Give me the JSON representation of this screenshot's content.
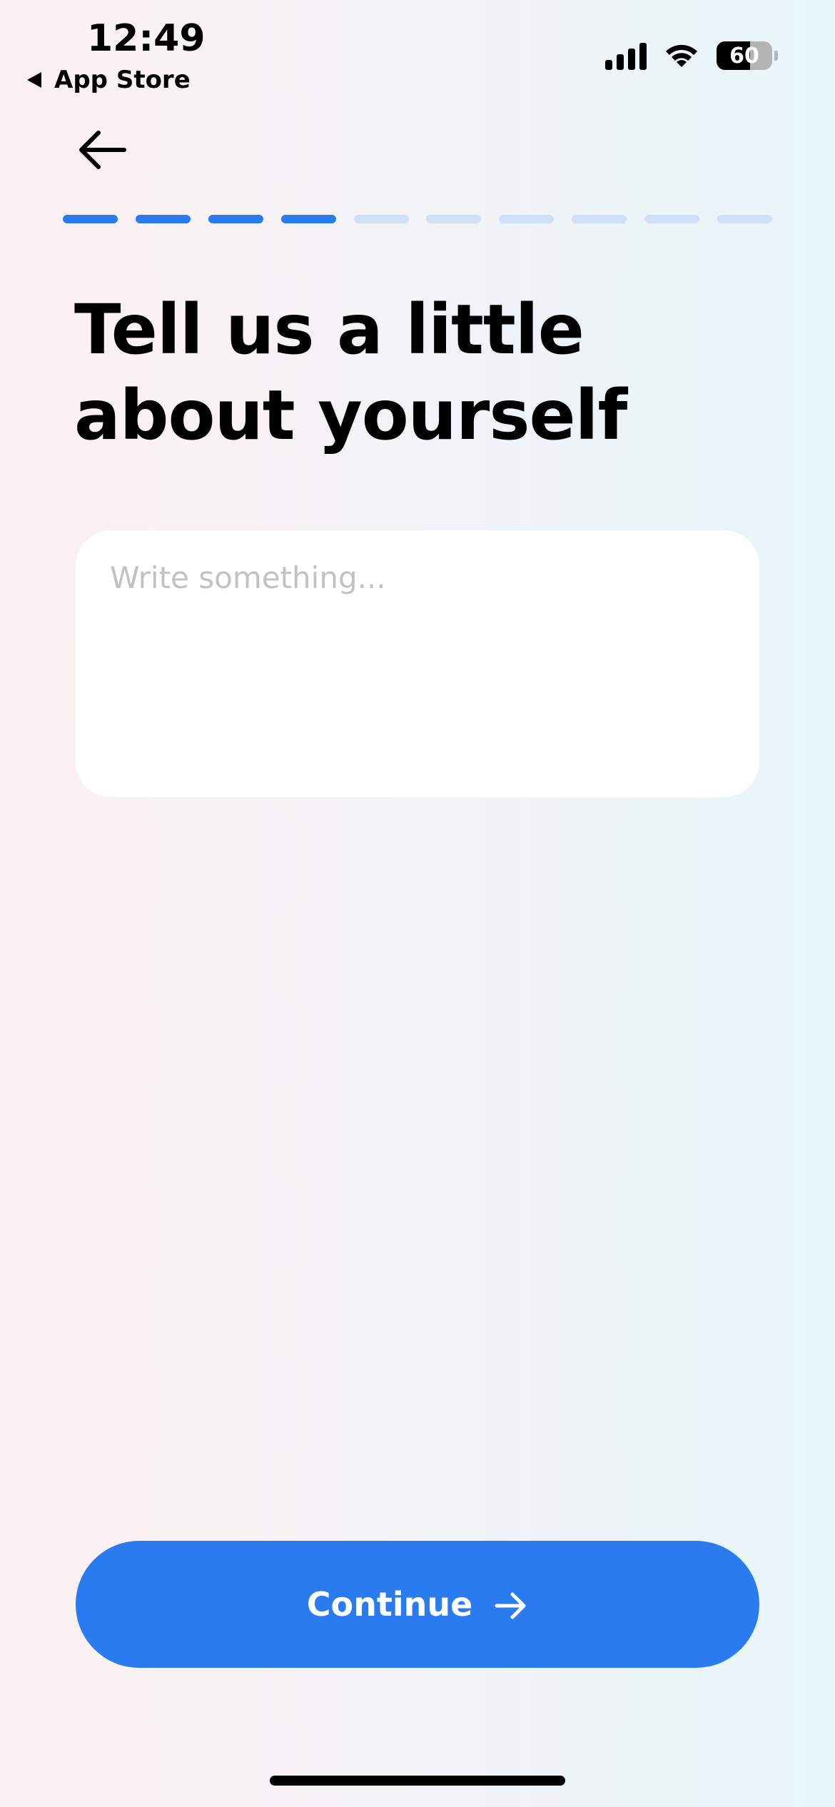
{
  "status_bar": {
    "time": "12:49",
    "back_app": "App Store",
    "battery": "60",
    "battery_level": 0.6
  },
  "progress": {
    "total_steps": 10,
    "completed_steps": 4
  },
  "colors": {
    "accent": "#2a7af0",
    "progress_inactive": "#cfe0f6",
    "placeholder": "#c2c2c2"
  },
  "icons": {
    "back": "arrow-left-icon",
    "continue": "arrow-right-icon"
  },
  "main": {
    "title": "Tell us a little about yourself",
    "input": {
      "placeholder": "Write something...",
      "value": ""
    },
    "continue_label": "Continue"
  }
}
